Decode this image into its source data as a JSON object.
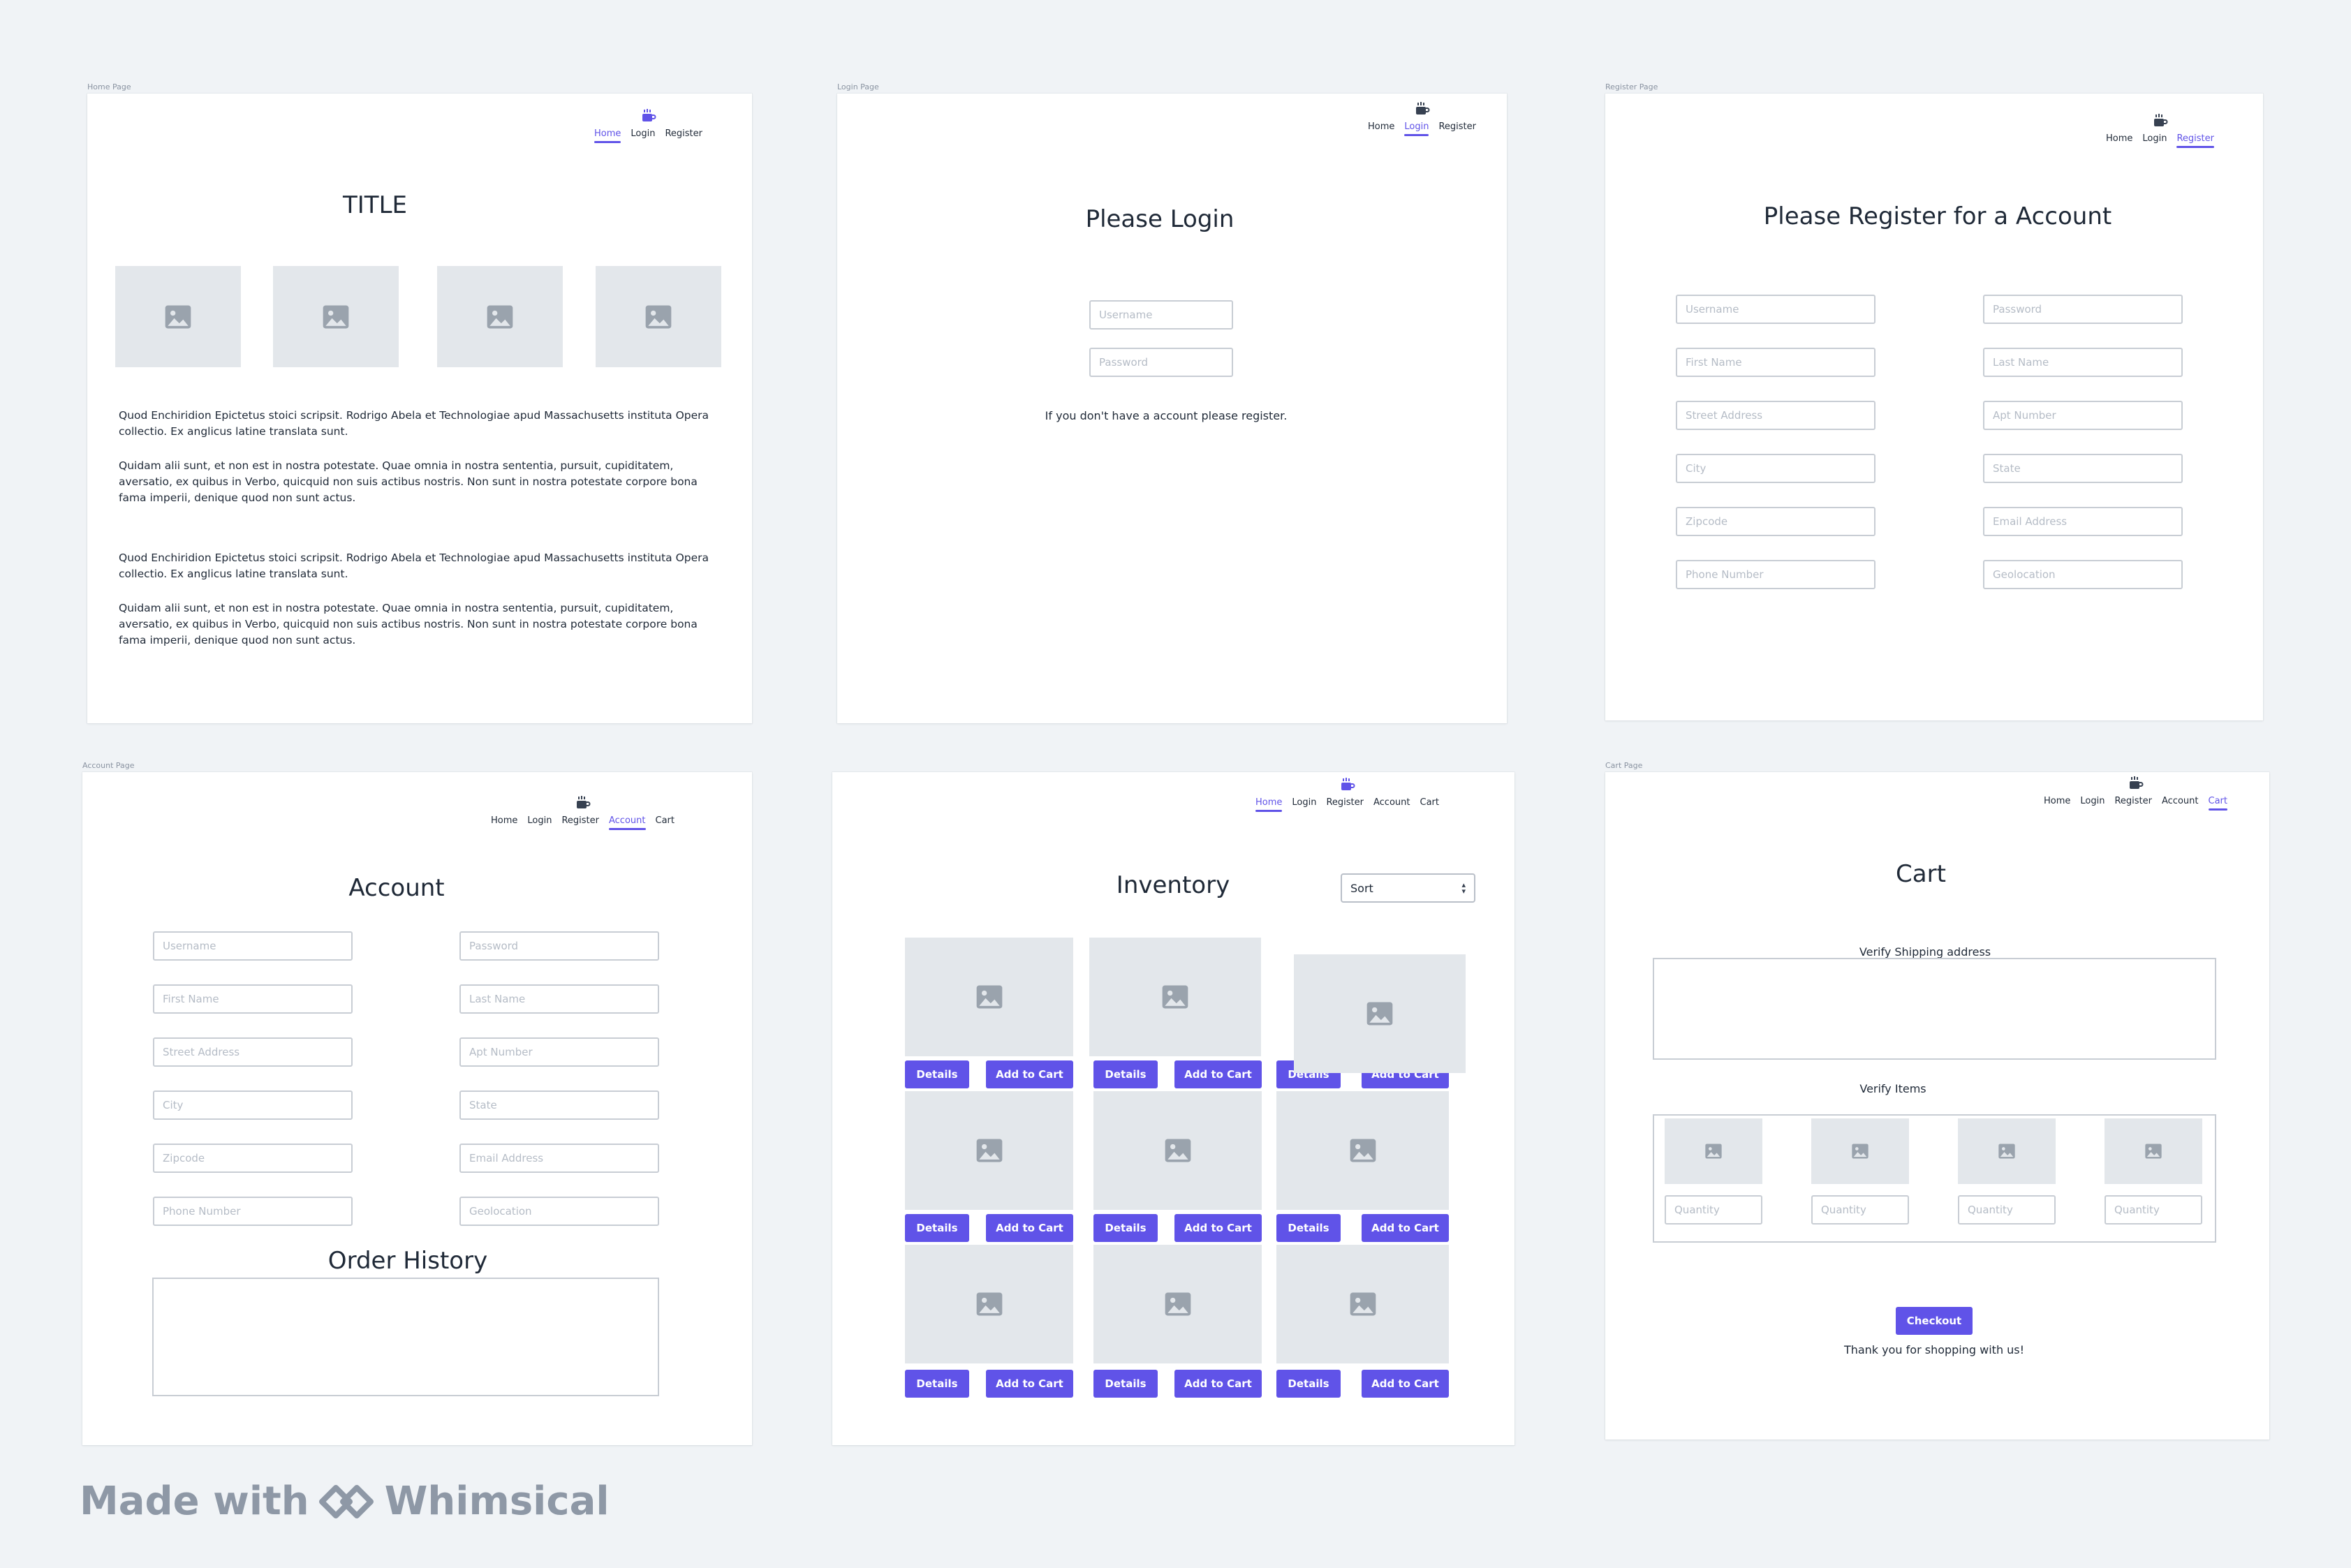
{
  "nav_labels": [
    "Home",
    "Login",
    "Register",
    "Account",
    "Cart"
  ],
  "frames": {
    "home": {
      "label": "Home Page",
      "nav": [
        "Home",
        "Login",
        "Register"
      ],
      "title": "TITLE",
      "paragraphs": [
        "Quod Enchiridion Epictetus stoici scripsit. Rodrigo Abela et Technologiae apud Massachusetts instituta Opera collectio. Ex anglicus latine translata sunt.",
        "Quidam alii sunt, et non est in nostra potestate. Quae omnia in nostra sententia, pursuit, cupiditatem, aversatio, ex quibus in Verbo, quicquid non suis actibus nostris. Non sunt in nostra potestate corpore bona fama imperii, denique quod non sunt actus.",
        "Quod Enchiridion Epictetus stoici scripsit. Rodrigo Abela et Technologiae apud Massachusetts instituta Opera collectio. Ex anglicus latine translata sunt.",
        "Quidam alii sunt, et non est in nostra potestate. Quae omnia in nostra sententia, pursuit, cupiditatem, aversatio, ex quibus in Verbo, quicquid non suis actibus nostris. Non sunt in nostra potestate corpore bona fama imperii, denique quod non sunt actus."
      ]
    },
    "login": {
      "label": "Login Page",
      "nav": [
        "Home",
        "Login",
        "Register"
      ],
      "title": "Please Login",
      "username_placeholder": "Username",
      "password_placeholder": "Password",
      "note": "If you don't have a account please register."
    },
    "register": {
      "label": "Register Page",
      "nav": [
        "Home",
        "Login",
        "Register"
      ],
      "title": "Please Register for a Account",
      "fields": [
        "Username",
        "Password",
        "First Name",
        "Last Name",
        "Street Address",
        "Apt Number",
        "City",
        "State",
        "Zipcode",
        "Email Address",
        "Phone Number",
        "Geolocation"
      ]
    },
    "account": {
      "label": "Account Page",
      "nav": [
        "Home",
        "Login",
        "Register",
        "Account",
        "Cart"
      ],
      "title": "Account",
      "fields": [
        "Username",
        "Password",
        "First Name",
        "Last Name",
        "Street Address",
        "Apt Number",
        "City",
        "State",
        "Zipcode",
        "Email Address",
        "Phone Number",
        "Geolocation"
      ],
      "order_history_title": "Order History"
    },
    "inventory": {
      "nav": [
        "Home",
        "Login",
        "Register",
        "Account",
        "Cart"
      ],
      "title": "Inventory",
      "sort_label": "Sort",
      "details_label": "Details",
      "add_to_cart_label": "Add to Cart"
    },
    "cart": {
      "label": "Cart Page",
      "nav": [
        "Home",
        "Login",
        "Register",
        "Account",
        "Cart"
      ],
      "title": "Cart",
      "verify_shipping": "Verify Shipping address",
      "verify_items": "Verify Items",
      "quantity_placeholder": "Quantity",
      "checkout_label": "Checkout",
      "thanks": "Thank you for shopping with us!"
    }
  },
  "watermark": {
    "prefix": "Made with",
    "brand": "Whimsical"
  },
  "colors": {
    "accent": "#6053e8",
    "placeholder_bg": "#e3e7eb",
    "canvas": "#f0f3f6"
  }
}
